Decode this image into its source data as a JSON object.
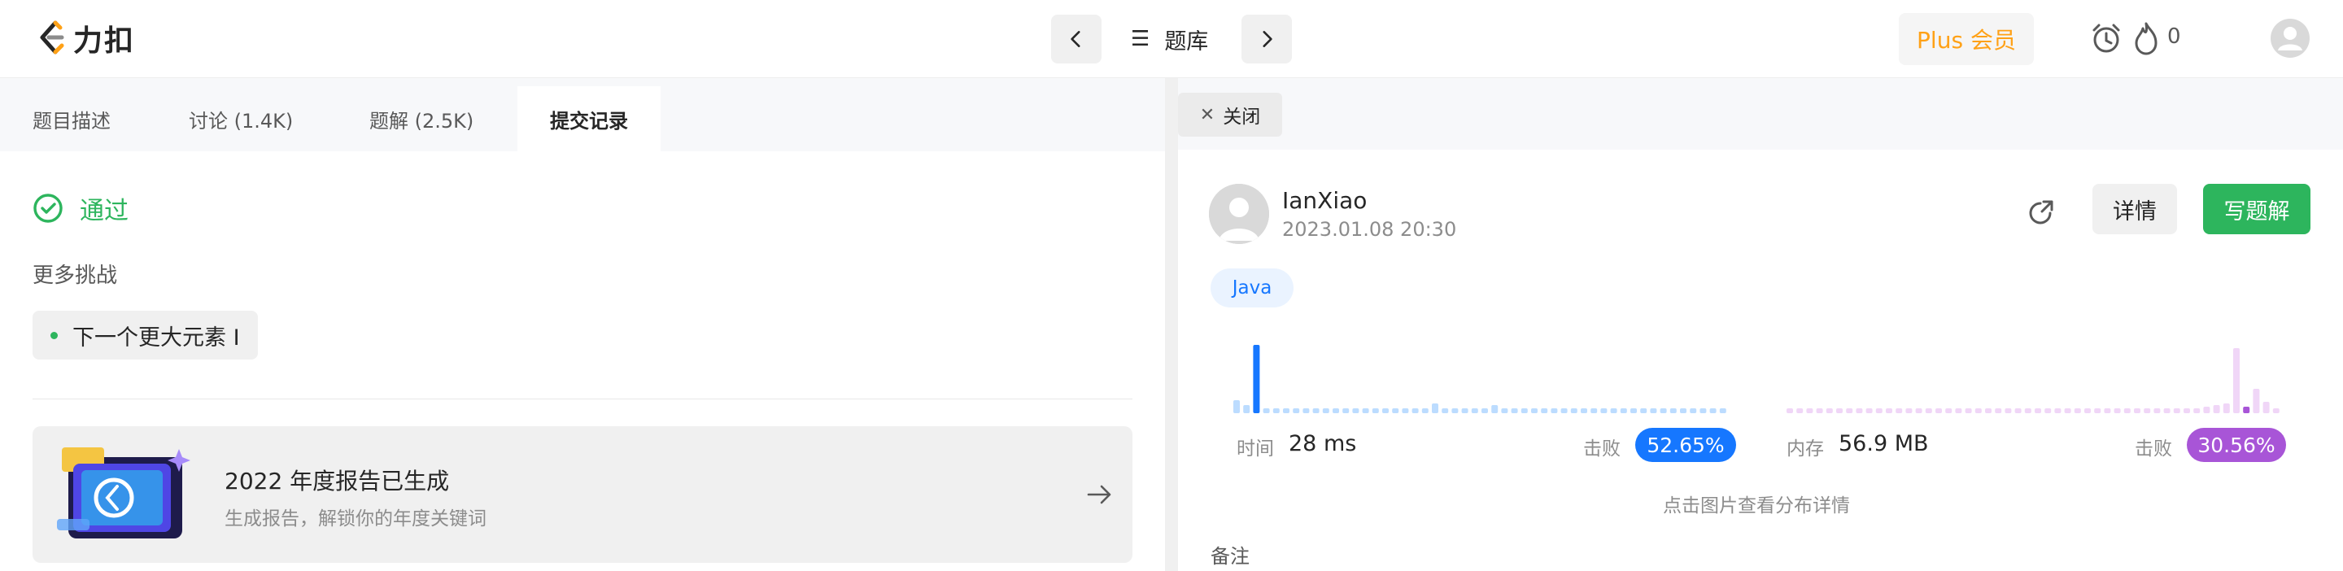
{
  "brand": {
    "logo_text": "力扣"
  },
  "topnav": {
    "problem_list_label": "题库",
    "plus_label": "Plus 会员",
    "streak_count": "0"
  },
  "left": {
    "tabs": [
      {
        "label": "题目描述"
      },
      {
        "label": "讨论 (1.4K)"
      },
      {
        "label": "题解 (2.5K)"
      },
      {
        "label": "提交记录"
      }
    ],
    "status_label": "通过",
    "more_label": "更多挑战",
    "next_problem": "下一个更大元素 I",
    "report": {
      "title": "2022 年度报告已生成",
      "subtitle": "生成报告，解锁你的年度关键词"
    }
  },
  "right": {
    "close_label": "关闭",
    "user": {
      "name": "IanXiao",
      "date": "2023.01.08 20:30"
    },
    "detail_label": "详情",
    "write_label": "写题解",
    "language": "Java",
    "runtime": {
      "label": "时间",
      "value": "28 ms",
      "beat_label": "击败",
      "beat": "52.65%"
    },
    "memory": {
      "label": "内存",
      "value": "56.9 MB",
      "beat_label": "击败",
      "beat": "30.56%"
    },
    "hint": "点击图片查看分布详情",
    "notes_label": "备注"
  },
  "colors": {
    "accent_green": "#2db55d",
    "runtime_blue": "#1677ff",
    "memory_purple": "#a855d7",
    "plus_orange": "#ffa116"
  }
}
